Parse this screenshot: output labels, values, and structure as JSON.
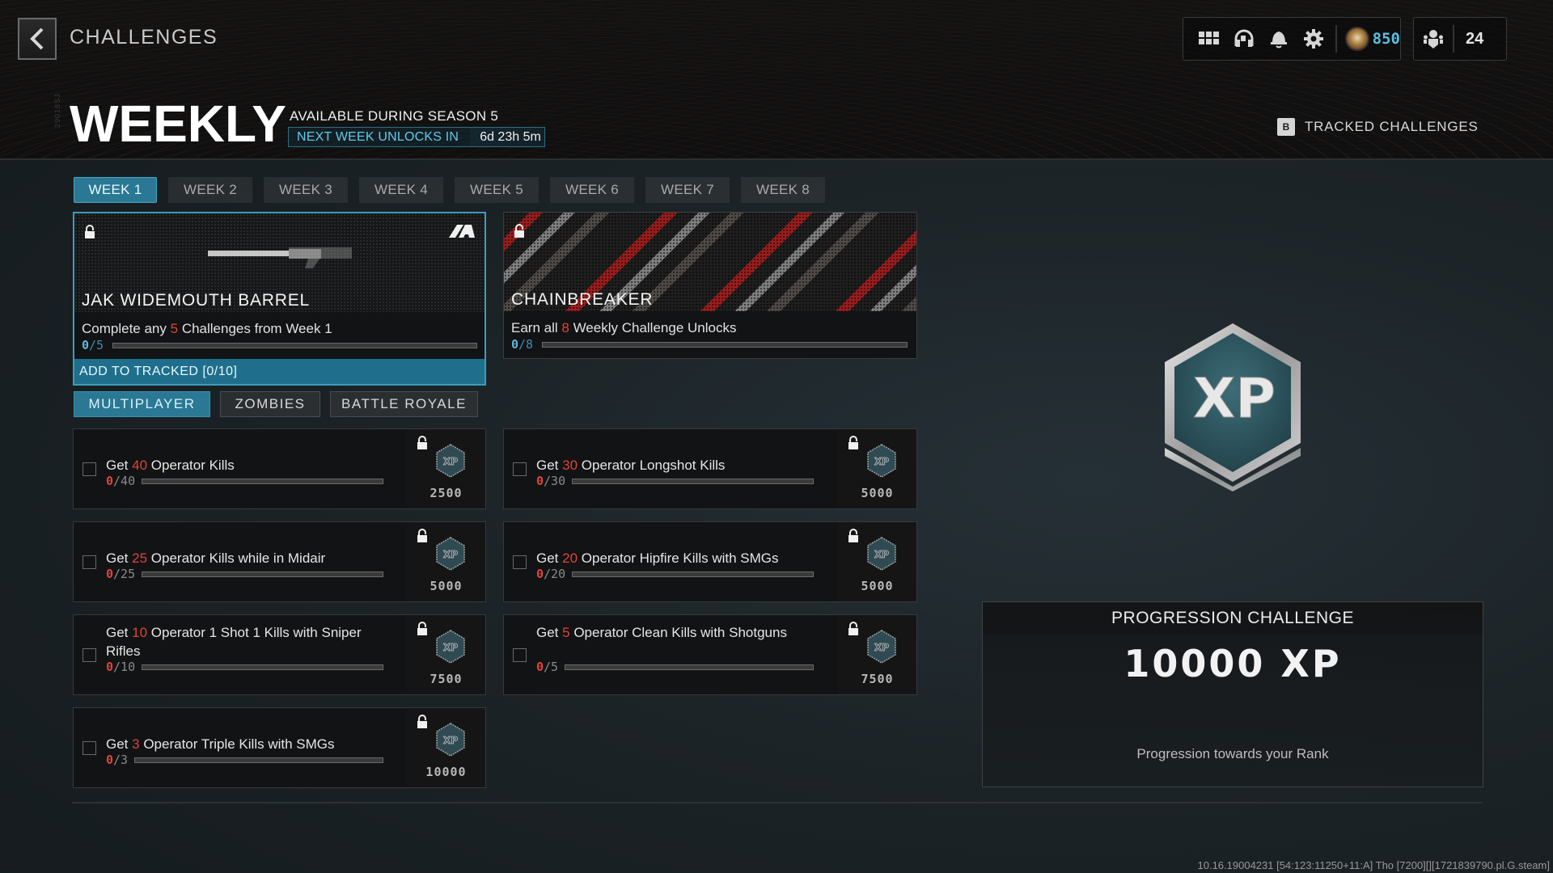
{
  "header": {
    "back_label": "back",
    "crumb": "CHALLENGES",
    "side_code": "29018SJ",
    "currency_value": "850",
    "party_count": "24",
    "icons": [
      "apps-grid-icon",
      "headset-icon",
      "bell-icon",
      "gear-icon",
      "currency-badge-icon",
      "party-icon"
    ]
  },
  "title": {
    "main": "WEEKLY",
    "season": "AVAILABLE DURING SEASON 5",
    "unlock_label": "NEXT WEEK UNLOCKS IN",
    "unlock_time": "6d 23h 5m"
  },
  "tracked": {
    "key": "B",
    "label": "TRACKED CHALLENGES"
  },
  "week_tabs": [
    {
      "label": "WEEK 1",
      "active": true
    },
    {
      "label": "WEEK 2",
      "active": false
    },
    {
      "label": "WEEK 3",
      "active": false
    },
    {
      "label": "WEEK 4",
      "active": false
    },
    {
      "label": "WEEK 5",
      "active": false
    },
    {
      "label": "WEEK 6",
      "active": false
    },
    {
      "label": "WEEK 7",
      "active": false
    },
    {
      "label": "WEEK 8",
      "active": false
    }
  ],
  "rewards": [
    {
      "name": "JAK WIDEMOUTH BARREL",
      "desc_pre": "Complete any ",
      "desc_num": "5",
      "desc_post": " Challenges from Week 1",
      "progress_current": "0",
      "progress_total": "/5",
      "progress_fraction": 0,
      "track_label": "ADD TO TRACKED [0/10]"
    },
    {
      "name": "CHAINBREAKER",
      "desc_pre": "Earn all ",
      "desc_num": "8",
      "desc_post": " Weekly Challenge Unlocks",
      "progress_current": "0",
      "progress_total": "/8",
      "progress_fraction": 0
    }
  ],
  "mode_tabs": [
    {
      "label": "MULTIPLAYER",
      "active": true
    },
    {
      "label": "ZOMBIES",
      "active": false
    },
    {
      "label": "BATTLE ROYALE",
      "active": false
    }
  ],
  "challenges": [
    {
      "pre": "Get ",
      "num": "40",
      "post": " Operator Kills",
      "current": "0",
      "total": "/40",
      "fraction": 0,
      "xp": "2500"
    },
    {
      "pre": "Get ",
      "num": "30",
      "post": " Operator Longshot Kills",
      "current": "0",
      "total": "/30",
      "fraction": 0,
      "xp": "5000"
    },
    {
      "pre": "Get ",
      "num": "25",
      "post": " Operator Kills while in Midair",
      "current": "0",
      "total": "/25",
      "fraction": 0,
      "xp": "5000"
    },
    {
      "pre": "Get ",
      "num": "20",
      "post": " Operator Hipfire Kills with SMGs",
      "current": "0",
      "total": "/20",
      "fraction": 0,
      "xp": "5000"
    },
    {
      "pre": "Get ",
      "num": "10",
      "post": " Operator 1 Shot 1 Kills with Sniper Rifles",
      "current": "0",
      "total": "/10",
      "fraction": 0,
      "xp": "7500"
    },
    {
      "pre": "Get ",
      "num": "5",
      "post": " Operator Clean Kills with Shotguns",
      "current": "0",
      "total": "/5",
      "fraction": 0,
      "xp": "7500"
    },
    {
      "pre": "Get ",
      "num": "3",
      "post": " Operator Triple Kills with SMGs",
      "current": "0",
      "total": "/3",
      "fraction": 0,
      "xp": "10000"
    }
  ],
  "progression": {
    "emblem_text": "XP",
    "heading": "PROGRESSION CHALLENGE",
    "xp": "10000 XP",
    "sub": "Progression towards your Rank"
  },
  "build_info": "10.16.19004231 [54:123:11250+11:A] Tho [7200][][1721839790.pl.G.steam]",
  "colors": {
    "accent_blue": "#2a7893",
    "highlight_red": "#e0433a",
    "currency_blue": "#58c0e3"
  }
}
